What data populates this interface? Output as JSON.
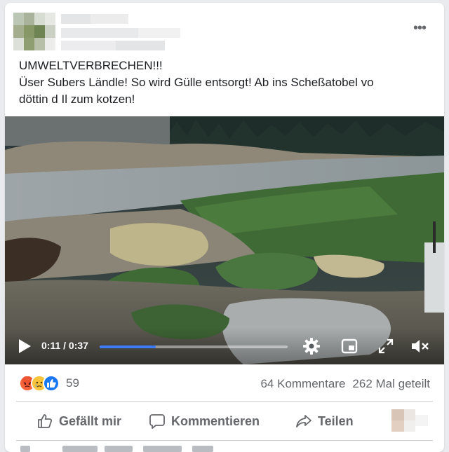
{
  "post": {
    "author_blurred": true,
    "more_icon": "more-horizontal-icon",
    "more_glyph": "•••",
    "text_lines": [
      "UMWELTVERBRECHEN!!!",
      "Üser Subers Ländle! So wird Gülle entsorgt! Ab ins Scheßatobel vo",
      "döttin d Il zum kotzen!"
    ]
  },
  "video": {
    "current_time": "0:11",
    "duration": "0:37",
    "time_label": "0:11 / 0:37",
    "progress_fraction": 0.297,
    "accent_color": "#3b7bf5"
  },
  "stats": {
    "reaction_icons": [
      "angry-reaction-icon",
      "sad-reaction-icon",
      "like-reaction-icon"
    ],
    "reaction_count": "59",
    "comments": "64 Kommentare",
    "shares": "262 Mal geteilt"
  },
  "actions": {
    "like_label": "Gefällt mir",
    "comment_label": "Kommentieren",
    "share_label": "Teilen"
  }
}
